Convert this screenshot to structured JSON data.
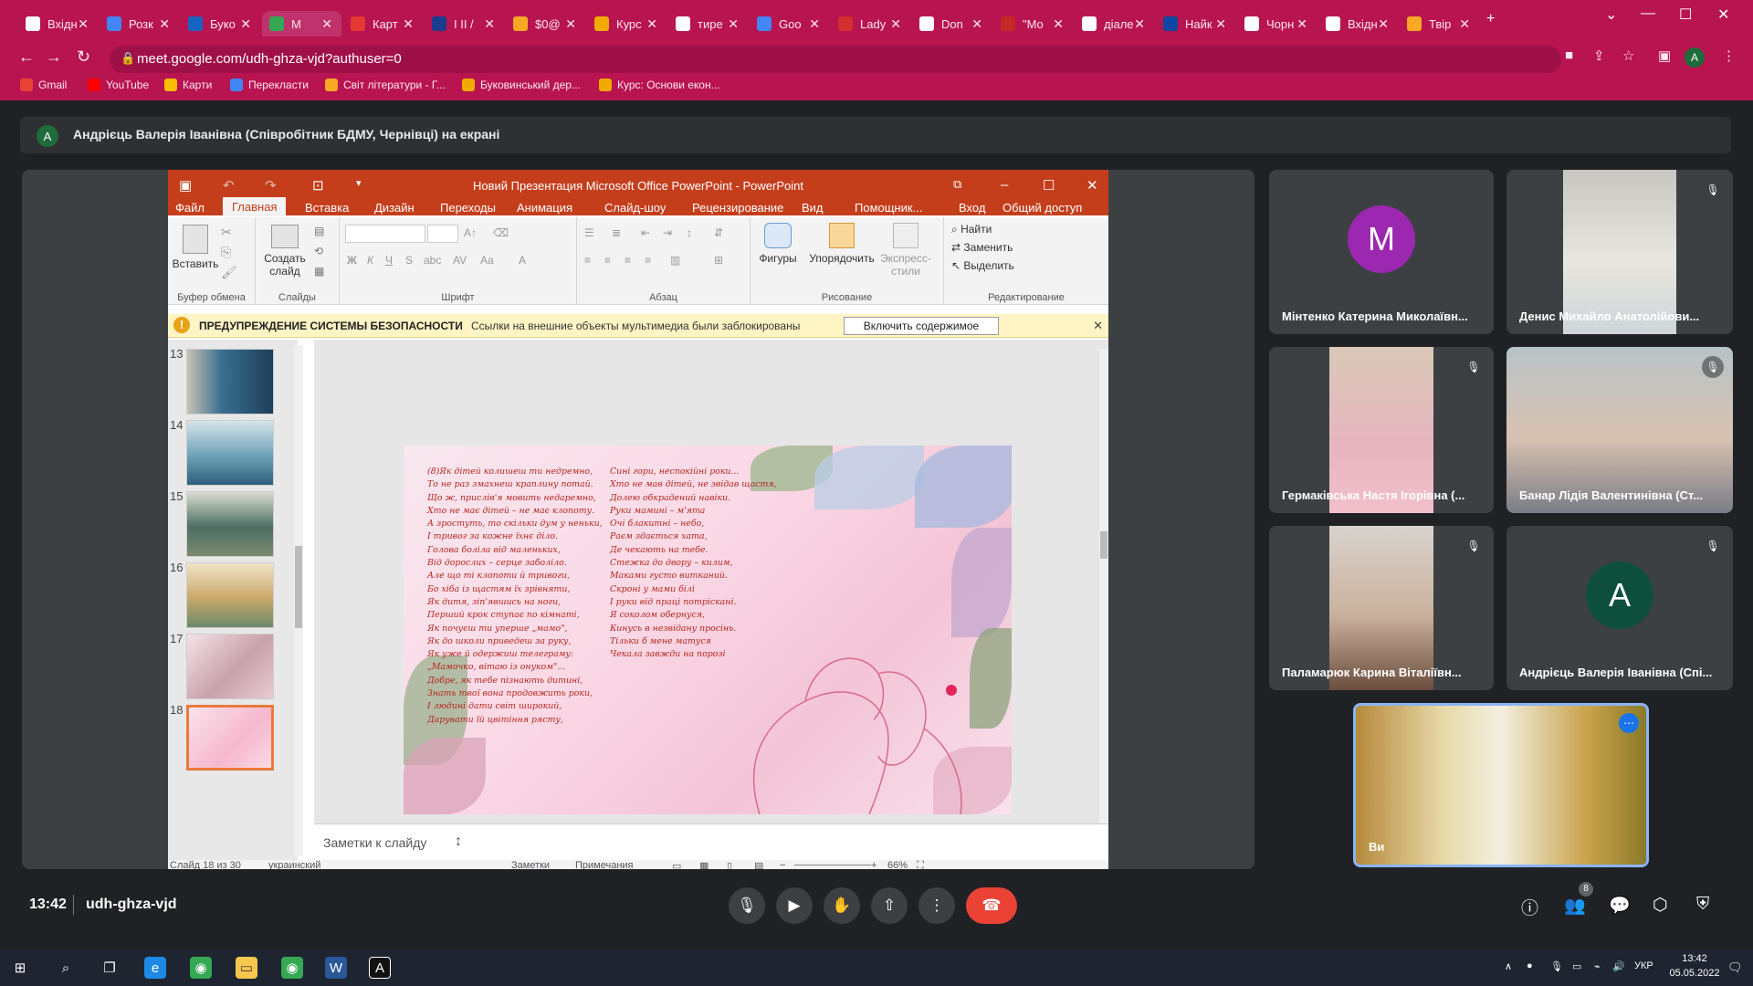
{
  "browser": {
    "tabs": [
      {
        "label": "Вхідн",
        "color": "#ffffff"
      },
      {
        "label": "Розк",
        "color": "#4285f4"
      },
      {
        "label": "Буко",
        "color": "#1565c0"
      },
      {
        "label": "M",
        "color": "#34a853"
      },
      {
        "label": "Карт",
        "color": "#e53935"
      },
      {
        "label": "I II /",
        "color": "#1a3d8f"
      },
      {
        "label": "$0@",
        "color": "#f9a825"
      },
      {
        "label": "Курс",
        "color": "#f2a900"
      },
      {
        "label": "тире",
        "color": "#ffffff"
      },
      {
        "label": "Goo",
        "color": "#4285f4"
      },
      {
        "label": "Lady",
        "color": "#d32f2f"
      },
      {
        "label": "Don",
        "color": "#ffffff"
      },
      {
        "label": "\"Mo",
        "color": "#c62828"
      },
      {
        "label": "діале",
        "color": "#ffffff"
      },
      {
        "label": "Найк",
        "color": "#0d47a1"
      },
      {
        "label": "Чорн",
        "color": "#ffffff"
      },
      {
        "label": "Вхідн",
        "color": "#ffffff"
      },
      {
        "label": "Твір",
        "color": "#f9a825"
      }
    ],
    "url": "meet.google.com/udh-ghza-vjd?authuser=0",
    "bookmarks": [
      {
        "label": "Gmail",
        "color": "#ea4335"
      },
      {
        "label": "YouTube",
        "color": "#ff0000"
      },
      {
        "label": "Карти",
        "color": "#fbbc04"
      },
      {
        "label": "Перекласти",
        "color": "#4285f4"
      },
      {
        "label": "Світ літератури - Г...",
        "color": "#f9a825"
      },
      {
        "label": "Буковинський дер...",
        "color": "#f2a900"
      },
      {
        "label": "Курс: Основи екон...",
        "color": "#f2a900"
      }
    ],
    "profile_initial": "A"
  },
  "meet": {
    "presenting_initial": "A",
    "presenting_text": "Андрієць Валерія Іванівна (Співробітник БДМУ, Чернівці) на екрані",
    "clock": "13:42",
    "code": "udh-ghza-vjd",
    "people_count": "8",
    "participants": [
      {
        "name": "Мінтенко Катерина Миколаївн...",
        "initial": "M",
        "avatar_color": "#9c27b0"
      },
      {
        "name": "Денис Михайло Анатолійови...",
        "video": true
      },
      {
        "name": "Гермаківська Настя Ігорівна (...",
        "video": true
      },
      {
        "name": "Банар Лідія Валентинівна (Ст...",
        "video": true
      },
      {
        "name": "Паламарюк Карина Віталіївн...",
        "video": true
      },
      {
        "name": "Андрієць Валерія Іванівна (Спі...",
        "initial": "A",
        "avatar_color": "#0d4f3c"
      },
      {
        "name": "Ви",
        "video": true
      }
    ]
  },
  "ppt": {
    "title": "Новий Презентация Microsoft Office PowerPoint - PowerPoint",
    "tabs": [
      "Файл",
      "Главная",
      "Вставка",
      "Дизайн",
      "Переходы",
      "Анимация",
      "Слайд-шоу",
      "Рецензирование",
      "Вид",
      "Помощник...",
      "Вход",
      "Общий доступ"
    ],
    "ribbon": {
      "groups": [
        "Буфер обмена",
        "Слайды",
        "Шрифт",
        "Абзац",
        "Рисование",
        "Редактирование"
      ],
      "paste": "Вставить",
      "new_slide": "Создать слайд",
      "shapes": "Фигуры",
      "arrange": "Упорядочить",
      "quick_styles": "Экспресс-стили",
      "find": "Найти",
      "replace": "Заменить",
      "select": "Выделить"
    },
    "security": {
      "label": "ПРЕДУПРЕЖДЕНИЕ СИСТЕМЫ БЕЗОПАСНОСТИ",
      "message": "Ссылки на внешние объекты мультимедиа были заблокированы",
      "button": "Включить содержимое"
    },
    "thumbs": [
      "13",
      "14",
      "15",
      "16",
      "17",
      "18"
    ],
    "notes_placeholder": "Заметки к слайду",
    "status": {
      "slide": "Слайд 18 из 30",
      "lang": "украинский",
      "notes": "Заметки",
      "comments": "Примечания",
      "zoom": "66%"
    },
    "poem_left": [
      "(8)Як дітей колишеш ти недремно,",
      "То не раз змахнеш краплину потай.",
      "Що ж, прислів'я мовить недаремно,",
      "Хто не має дітей – не має клопоту.",
      "А зростуть, то скільки дум у неньки,",
      "І тривог за кожне їхнє діло.",
      "Голова боліла від маленьких,",
      "Від дорослих – серце заболіло.",
      "Але що ті клопоти й тривоги,",
      "Бо хіба із щастям їх зрівняти,",
      "Як дитя, зіп'явшись на ноги,",
      "Перший крок ступає по кімнаті,",
      "Як почуєш ти уперше „мамо\",",
      "Як до школи приведеш за руку,",
      "Як уже й одержиш телеграму:",
      "„Мамочко, вітаю із онуком\"...",
      "Добре, як тебе пізнають дитині,",
      "Знать твої вона продовжить роки,",
      "І людині дати світ широкий,",
      "Дарувати їй цвітіння рясту,"
    ],
    "poem_right": [
      "Сині гори, неспокійні роки...",
      "Хто не мав дітей, не звідав щастя,",
      "Долею обкрадений навіки.",
      "Руки мамині – м'ята",
      "Очі блакитні – небо,",
      "Раєм здається хата,",
      "Де чекають на тебе.",
      "Стежка до двору – килим,",
      "Маками густо витканий.",
      "Скроні у мами білі",
      "І руки від праці потріскані.",
      "Я соколом обернуся,",
      "Кинусь в незвідану просінь.",
      "Тільки б мене матуся",
      "Чекала завжди на порозі"
    ]
  },
  "taskbar": {
    "lang": "УКР",
    "time": "13:42",
    "date": "05.05.2022"
  }
}
